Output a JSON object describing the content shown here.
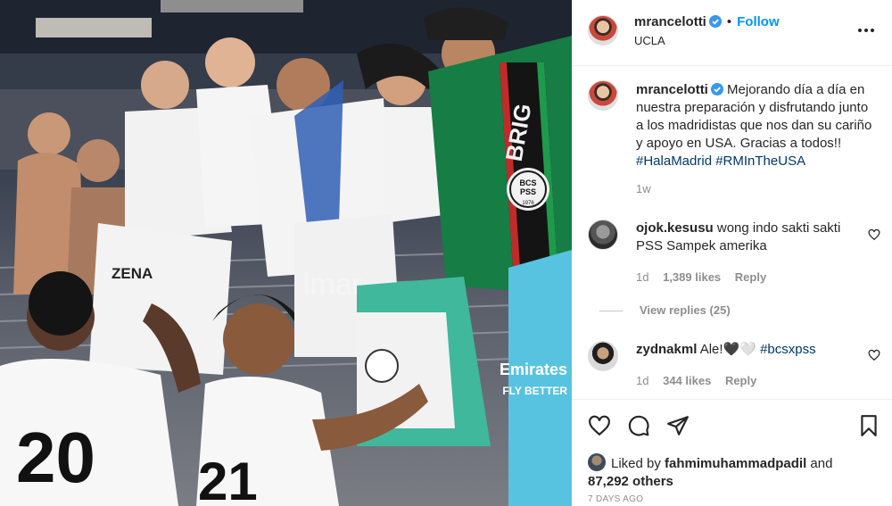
{
  "post": {
    "author": "mrancelotti",
    "follow_label": "Follow",
    "separator": "•",
    "location": "UCLA",
    "more_icon": "more-horizontal-icon",
    "caption_text": "Mejorando día a día en nuestra preparación y disfrutando junto a los madridistas que nos dan su cariño y apoyo en USA. Gracias a todos!! ",
    "hashtags": [
      "#HalaMadrid",
      "#RMInTheUSA"
    ],
    "caption_age": "1w",
    "photo_watermark": "lmar"
  },
  "comments": [
    {
      "user": "ojok.kesusu",
      "text": "wong indo sakti sakti PSS Sampek amerika",
      "age": "1d",
      "likes": "1,389 likes",
      "reply": "Reply",
      "view_replies": "View replies (25)"
    },
    {
      "user": "zydnakml",
      "text": "Ale!🖤🤍",
      "hashtag": "#bcsxpss",
      "age": "1d",
      "likes": "344 likes",
      "reply": "Reply"
    }
  ],
  "footer": {
    "liked_prefix": "Liked by",
    "liked_user": "fahmimuhammadpadil",
    "liked_and": "and",
    "liked_others": "87,292 others",
    "time_ago": "7 DAYS AGO"
  },
  "jerseys": {
    "player_left_number": "20",
    "player_right_number": "21",
    "shirt_name": "ZENA",
    "scarf_text": "BRIG",
    "badge_top": "BCS",
    "badge_mid": "PSS",
    "badge_year": "1976",
    "sponsor": "Emirates",
    "sponsor2": "FLY BETTER"
  },
  "colors": {
    "accent": "#0095f6",
    "hashtag": "#00376b",
    "muted": "#8e8e8e",
    "text": "#262626",
    "verified": "#3897f0"
  }
}
